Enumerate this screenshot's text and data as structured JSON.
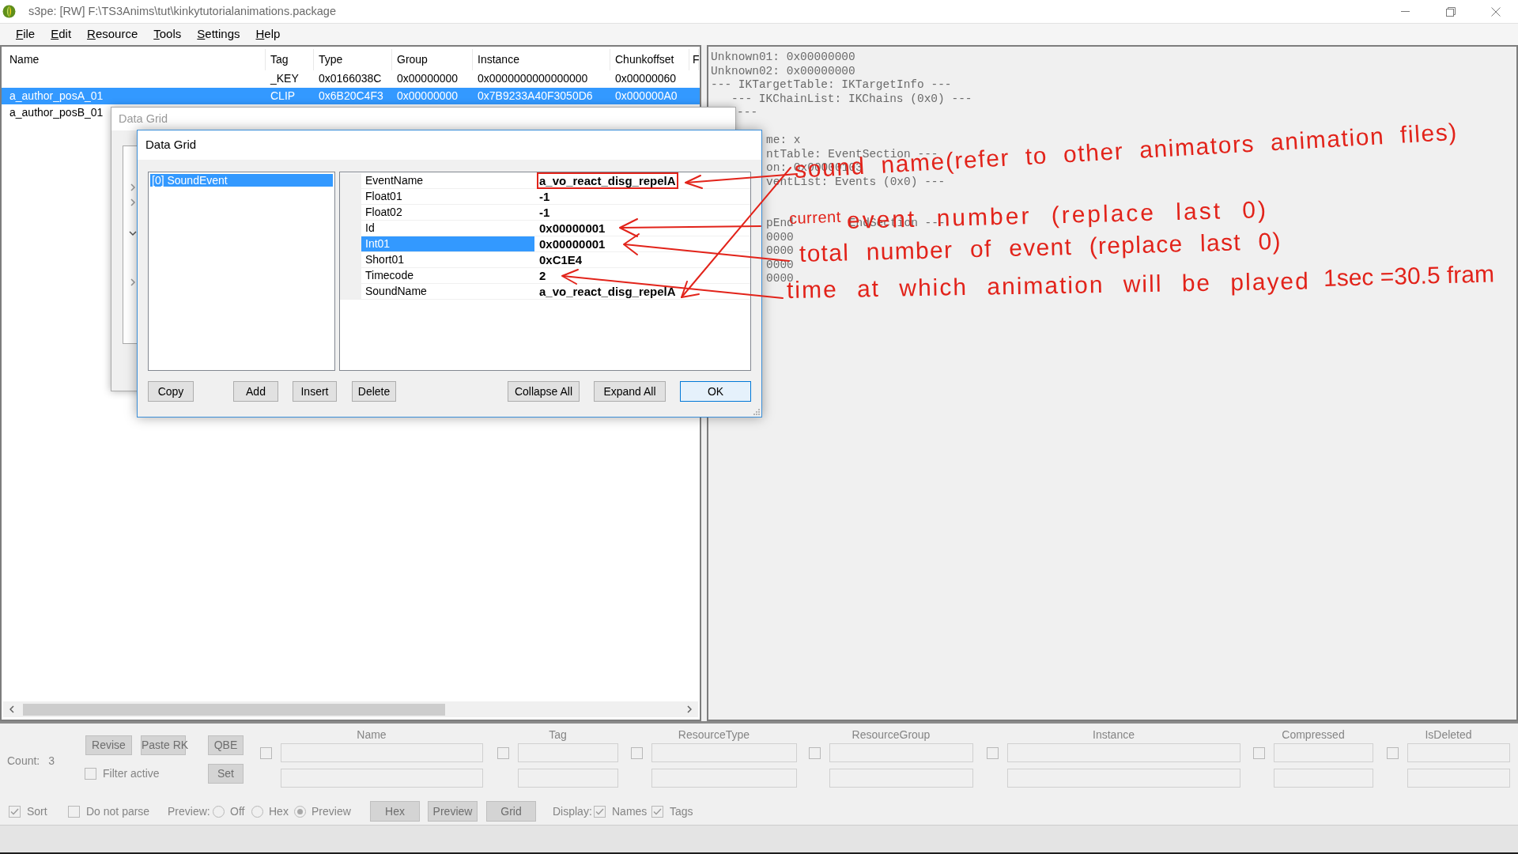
{
  "window": {
    "title": "s3pe: [RW] F:\\TS3Anims\\tut\\kinkytutorialanimations.package"
  },
  "menu": [
    "File",
    "Edit",
    "Resource",
    "Tools",
    "Settings",
    "Help"
  ],
  "resource_list": {
    "columns": [
      "Name",
      "Tag",
      "Type",
      "Group",
      "Instance",
      "Chunkoffset",
      "F"
    ],
    "rows": [
      {
        "tag": "_KEY",
        "type": "0x0166038C",
        "group": "0x00000000",
        "instance": "0x0000000000000000",
        "chunkoffset": "0x00000060",
        "selected": false
      },
      {
        "name": "a_author_posA_01",
        "tag": "CLIP",
        "type": "0x6B20C4F3",
        "group": "0x00000000",
        "instance": "0x7B9233A40F3050D6",
        "chunkoffset": "0x000000A0",
        "selected": true
      },
      {
        "name": "a_author_posB_01",
        "selected": false
      }
    ]
  },
  "preview_text": {
    "lines": [
      {
        "kind": "full",
        "text": "Unknown01: 0x00000000"
      },
      {
        "kind": "full",
        "text": "Unknown02: 0x00000000"
      },
      {
        "kind": "full",
        "text": "--- IKTargetTable: IKTargetInfo ---"
      },
      {
        "kind": "indented",
        "text": "--- IKChainList: IKChains (0x0) ---"
      },
      {
        "kind": "behind_back_dialog",
        "text": "---"
      },
      {
        "kind": "blank"
      },
      {
        "kind": "behind_dialog",
        "text": "me: x"
      },
      {
        "kind": "behind_dialog",
        "text": "ntTable: EventSection ---"
      },
      {
        "kind": "behind_dialog",
        "text": "on: 0x00000103"
      },
      {
        "kind": "behind_dialog",
        "text": "ventList: Events (0x0) ---"
      },
      {
        "kind": "blank"
      },
      {
        "kind": "blank"
      },
      {
        "kind": "behind_dialog",
        "text": "pEnd",
        "tail": "EndSection ---"
      },
      {
        "kind": "behind_dialog",
        "text": "0000"
      },
      {
        "kind": "behind_dialog",
        "text": "0000"
      },
      {
        "kind": "behind_dialog",
        "text": "0000"
      },
      {
        "kind": "behind_dialog",
        "text": "0000"
      }
    ]
  },
  "back_dialog": {
    "title": "Data Grid",
    "tree_expanders": [
      {
        "expanded": false
      },
      {
        "expanded": false
      },
      {
        "expanded": true
      },
      {
        "expanded": false
      }
    ]
  },
  "dialog": {
    "title": "Data Grid",
    "items": [
      {
        "label": "[0] SoundEvent",
        "selected": true
      }
    ],
    "properties": [
      {
        "name": "EventName",
        "value": "a_vo_react_disg_repelA",
        "selected": false,
        "marked": true
      },
      {
        "name": "Float01",
        "value": "-1",
        "selected": false,
        "marked": false
      },
      {
        "name": "Float02",
        "value": "-1",
        "selected": false,
        "marked": false
      },
      {
        "name": "Id",
        "value": "0x00000001",
        "selected": false,
        "marked": false
      },
      {
        "name": "Int01",
        "value": "0x00000001",
        "selected": true,
        "marked": false
      },
      {
        "name": "Short01",
        "value": "0xC1E4",
        "selected": false,
        "marked": false
      },
      {
        "name": "Timecode",
        "value": "2",
        "selected": false,
        "marked": false
      },
      {
        "name": "SoundName",
        "value": "a_vo_react_disg_repelA",
        "selected": false,
        "marked": false
      }
    ],
    "buttons": [
      {
        "label": "Copy",
        "default": false
      },
      {
        "label": "Add",
        "default": false
      },
      {
        "label": "Insert",
        "default": false
      },
      {
        "label": "Delete",
        "default": false
      },
      {
        "label": "Collapse All",
        "default": false
      },
      {
        "label": "Expand All",
        "default": false
      },
      {
        "label": "OK",
        "default": true
      }
    ]
  },
  "filter_panel": {
    "disabled": true,
    "count_label": "Count:",
    "count": "3",
    "buttons": [
      "Revise",
      "Paste RK",
      "QBE"
    ],
    "filter_active": {
      "label": "Filter active",
      "checked": false
    },
    "set_button": "Set",
    "columns": [
      {
        "label": "Name",
        "checked": false
      },
      {
        "label": "Tag",
        "checked": false
      },
      {
        "label": "ResourceType",
        "checked": false
      },
      {
        "label": "ResourceGroup",
        "checked": false
      },
      {
        "label": "Instance",
        "checked": false
      },
      {
        "label": "Compressed",
        "checked": false
      },
      {
        "label": "IsDeleted",
        "checked": false
      }
    ],
    "sort": {
      "label": "Sort",
      "checked": true
    },
    "do_not_parse": {
      "label": "Do not parse",
      "checked": false
    },
    "preview_label": "Preview:",
    "preview_modes": [
      {
        "label": "Off",
        "selected": false
      },
      {
        "label": "Hex",
        "selected": false
      },
      {
        "label": "Preview",
        "selected": true
      }
    ],
    "view_buttons": [
      "Hex",
      "Preview",
      "Grid"
    ],
    "display_label": "Display:",
    "display_options": [
      {
        "label": "Names",
        "checked": true
      },
      {
        "label": "Tags",
        "checked": true
      }
    ]
  },
  "annotations": [
    {
      "kind": "note",
      "text": "sound name(refer to other animators animation files)"
    },
    {
      "kind": "small",
      "text": "current"
    },
    {
      "kind": "note",
      "text": "event number (replace last 0)"
    },
    {
      "kind": "note",
      "text": "total number of event (replace last 0)"
    },
    {
      "kind": "note",
      "text": "time at which animation will be played"
    },
    {
      "kind": "note",
      "text": "1sec =30.5 fram"
    }
  ]
}
